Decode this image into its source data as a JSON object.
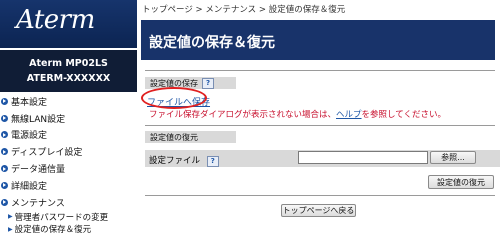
{
  "brand": {
    "logo_text": "Aterm",
    "model_line1": "Aterm MP02LS",
    "model_line2": "ATERM-XXXXXX"
  },
  "nav": {
    "items": [
      {
        "label": "基本設定"
      },
      {
        "label": "無線LAN設定"
      },
      {
        "label": "電源設定"
      },
      {
        "label": "ディスプレイ設定"
      },
      {
        "label": "データ通信量"
      },
      {
        "label": "詳細設定"
      },
      {
        "label": "メンテナンス"
      }
    ],
    "sub_items": [
      {
        "label": "管理者パスワードの変更"
      },
      {
        "label": "設定値の保存＆復元"
      }
    ]
  },
  "breadcrumb": "トップページ > メンテナンス > 設定値の保存＆復元",
  "page_title": "設定値の保存＆復元",
  "save_section": {
    "heading": "設定値の保存",
    "help": "?",
    "file_save_link": "ファイルへ保存",
    "note_before": "ファイル保存ダイアログが表示されない場合は、",
    "note_link": "ヘルプ",
    "note_after": "を参照してください。"
  },
  "restore_section": {
    "heading": "設定値の復元",
    "file_label": "設定ファイル",
    "help": "?",
    "file_value": "",
    "browse_label": "参照...",
    "restore_button": "設定値の復元"
  },
  "back_button": "トップページへ戻る",
  "colors": {
    "navy": "#18336a",
    "link": "#1e56a6",
    "warning": "#c8102e",
    "highlight_circle": "#e02020"
  }
}
